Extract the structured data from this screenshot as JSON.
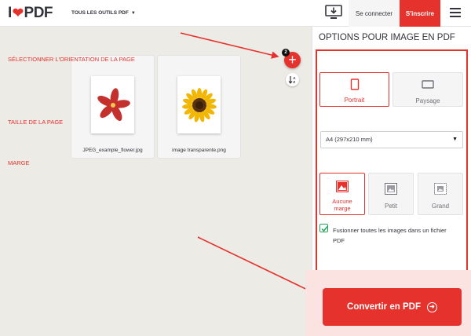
{
  "header": {
    "logo_prefix": "I",
    "logo_suffix": "PDF",
    "tools_label": "TOUS LES OUTILS PDF",
    "login_label": "Se connecter",
    "signup_label": "S'inscrire"
  },
  "workspace": {
    "file_count": "2",
    "files": [
      {
        "name": "JPEG_example_flower.jpg",
        "icon": "red-flower-image"
      },
      {
        "name": "image transparente.png",
        "icon": "sunflower-image"
      }
    ]
  },
  "sidebar": {
    "title": "OPTIONS POUR IMAGE EN PDF",
    "orientation": {
      "label": "SÉLECTIONNER L'ORIENTATION DE LA PAGE",
      "options": [
        "Portrait",
        "Paysage"
      ],
      "selected": "Portrait"
    },
    "page_size": {
      "label": "TAILLE DE LA PAGE",
      "value": "A4 (297x210 mm)"
    },
    "margin": {
      "label": "MARGE",
      "options": [
        "Aucune marge",
        "Petit",
        "Grand"
      ],
      "option_line1": "Aucune",
      "option_line2": "marge",
      "selected": "Aucune marge"
    },
    "merge": {
      "checked": true,
      "label": "Fusionner toutes les images dans un fichier PDF"
    },
    "convert_label": "Convertir en PDF"
  },
  "colors": {
    "accent": "#e5322d",
    "check": "#22a35c",
    "workspace_bg": "#ecebe6"
  }
}
